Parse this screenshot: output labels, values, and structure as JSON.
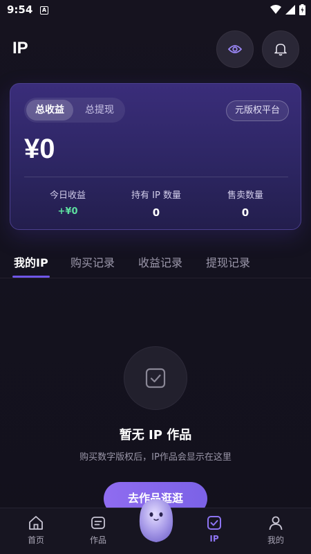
{
  "status_bar": {
    "time": "9:54",
    "app_badge": "A"
  },
  "header": {
    "title": "IP",
    "eye_icon": "eye-icon",
    "bell_icon": "bell-icon"
  },
  "card": {
    "tabs": [
      "总收益",
      "总提现"
    ],
    "platform_label": "元版权平台",
    "balance": "¥0",
    "stats": [
      {
        "label": "今日收益",
        "value": "+¥0"
      },
      {
        "label": "持有 IP 数量",
        "value": "0"
      },
      {
        "label": "售卖数量",
        "value": "0"
      }
    ]
  },
  "tabs": [
    "我的IP",
    "购买记录",
    "收益记录",
    "提现记录"
  ],
  "empty": {
    "title": "暂无 IP 作品",
    "description": "购买数字版权后，IP作品会显示在这里",
    "button_label": "去作品逛逛"
  },
  "bottom_nav": [
    {
      "label": "首页",
      "icon": "home-icon"
    },
    {
      "label": "作品",
      "icon": "works-icon"
    },
    {
      "label": "IP",
      "icon": "ip-check-icon"
    },
    {
      "label": "我的",
      "icon": "user-icon"
    }
  ],
  "colors": {
    "accent": "#6f56e8",
    "positive": "#5ee0a0",
    "background": "#13111c"
  }
}
